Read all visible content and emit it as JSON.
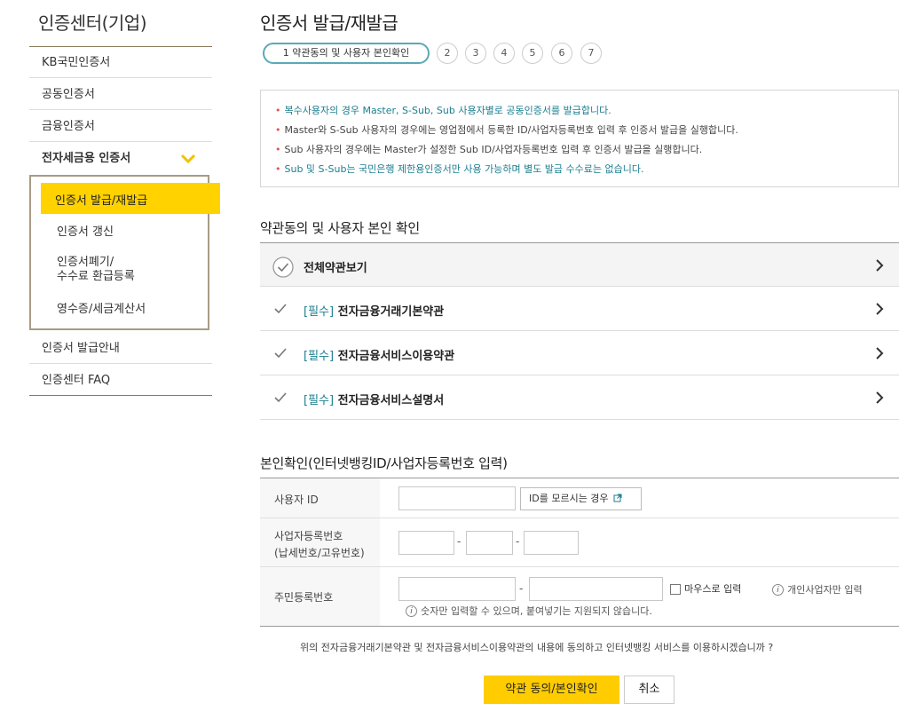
{
  "sidebar": {
    "title": "인증센터(기업)",
    "items": [
      {
        "label": "KB국민인증서"
      },
      {
        "label": "공동인증서"
      },
      {
        "label": "금융인증서"
      },
      {
        "label": "전자세금용 인증서"
      }
    ],
    "submenu": [
      {
        "label": "인증서 발급/재발급"
      },
      {
        "label": "인증서 갱신"
      },
      {
        "label": "인증서폐기/"
      },
      {
        "label": "수수료 환급등록"
      },
      {
        "label": "영수증/세금계산서"
      }
    ],
    "items_after": [
      {
        "label": "인증서 발급안내"
      },
      {
        "label": "인증센터 FAQ"
      }
    ]
  },
  "main": {
    "title": "인증서 발급/재발급",
    "steps": {
      "active": "1 약관동의 및 사용자 본인확인",
      "others": [
        "2",
        "3",
        "4",
        "5",
        "6",
        "7"
      ]
    },
    "notices": [
      "복수사용자의 경우 Master, S-Sub, Sub 사용자별로 공동인증서를 발급합니다.",
      "Master와 S-Sub 사용자의 경우에는 영업점에서 등록한 ID/사업자등록번호 입력 후 인증서 발급을 실행합니다.",
      "Sub 사용자의 경우에는 Master가 설정한 Sub ID/사업자등록번호 입력 후 인증서 발급을 실행합니다.",
      "Sub 및 S-Sub는 국민은행 제한용인증서만 사용 가능하며 별도 발급 수수료는 없습니다."
    ],
    "terms_title": "약관동의 및 사용자 본인 확인",
    "terms": {
      "all": "전체약관보기",
      "required_tag": "[필수]",
      "items": [
        {
          "label": "전자금융거래기본약관"
        },
        {
          "label": "전자금융서비스이용약관"
        },
        {
          "label": "전자금융서비스설명서"
        }
      ]
    },
    "identity_title": "본인확인(인터넷뱅킹ID/사업자등록번호 입력)",
    "form": {
      "user_id_label": "사용자 ID",
      "forgot_id_button": "ID를 모르시는 경우",
      "bizno_label_1": "사업자등록번호",
      "bizno_label_2": "(납세번호/고유번호)",
      "dash": "-",
      "rrn_label": "주민등록번호",
      "mouse_input": "마우스로 입력",
      "personal_only": "개인사업자만 입력",
      "digits_note": "숫자만 입력할 수 있으며, 붙여넣기는 지원되지 않습니다."
    },
    "agree_question": "위의 전자금융거래기본약관 및 전자금융서비스이용약관의 내용에 동의하고 인터넷뱅킹 서비스를 이용하시겠습니까 ?",
    "buttons": {
      "agree": "약관 동의/본인확인",
      "cancel": "취소"
    }
  },
  "colors": {
    "accent_yellow": "#ffd200",
    "teal": "#1b7e8f",
    "bullet_red": "#e94f4f"
  }
}
